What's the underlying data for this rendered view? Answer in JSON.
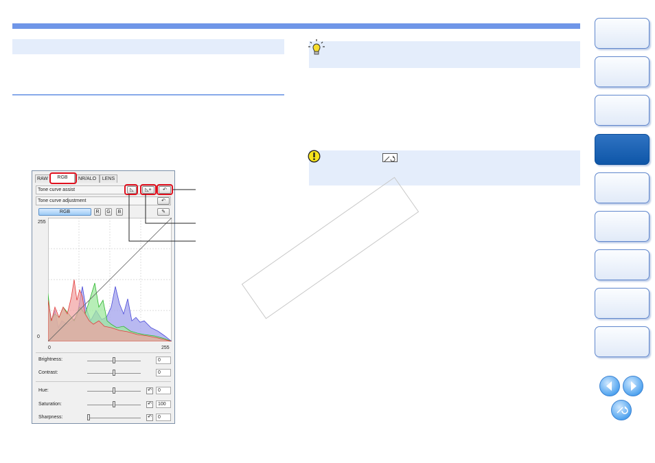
{
  "panel": {
    "tabs": [
      "RAW",
      "RGB",
      "NR/ALO",
      "LENS"
    ],
    "tone_curve_assist_label": "Tone curve assist",
    "tone_curve_adjustment_label": "Tone curve adjustment",
    "channels": [
      "RGB",
      "R",
      "G",
      "B"
    ],
    "axis": {
      "y_max": "255",
      "y_min": "0",
      "x_min": "0",
      "x_max": "255"
    },
    "sliders": [
      {
        "label": "Brightness:",
        "value": "0"
      },
      {
        "label": "Contrast:",
        "value": "0"
      },
      {
        "label": "Hue:",
        "value": "0"
      },
      {
        "label": "Saturation:",
        "value": "100"
      },
      {
        "label": "Sharpness:",
        "value": "0"
      }
    ],
    "slider_levels": [
      0.5,
      0.5,
      0.5,
      0.5,
      0.0
    ]
  },
  "colors": {
    "accent": "#6f96e8",
    "highlight": "#e0101e",
    "active_tab": "#0e56a8",
    "info_bg": "#e4edfb"
  },
  "icons": {
    "tip": "lightbulb-icon",
    "caution": "exclamation-icon",
    "reset": "reset-curve-icon",
    "nav_prev": "arrow-left-icon",
    "nav_next": "arrow-right-icon",
    "nav_back": "return-icon"
  }
}
